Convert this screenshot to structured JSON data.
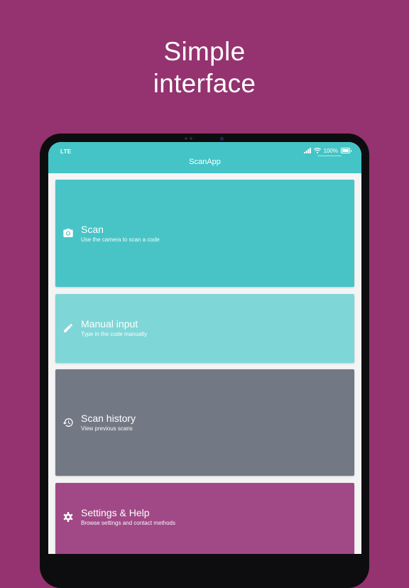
{
  "promo": {
    "headline_line1": "Simple",
    "headline_line2": "interface",
    "background_color": "#94336f"
  },
  "status_bar": {
    "carrier": "LTE",
    "battery": "100%"
  },
  "app_bar": {
    "title": "ScanApp",
    "color": "#44c4c6"
  },
  "menu": {
    "items": [
      {
        "title": "Scan",
        "subtitle": "Use the camera to scan a code",
        "icon": "camera-icon",
        "color": "#48c4c7"
      },
      {
        "title": "Manual input",
        "subtitle": "Type in the code manually",
        "icon": "pencil-icon",
        "color": "#7fd6d7"
      },
      {
        "title": "Scan history",
        "subtitle": "View previous scans",
        "icon": "history-icon",
        "color": "#737885"
      },
      {
        "title": "Settings & Help",
        "subtitle": "Browse settings and contact methods",
        "icon": "gear-icon",
        "color": "#a04986"
      }
    ]
  }
}
